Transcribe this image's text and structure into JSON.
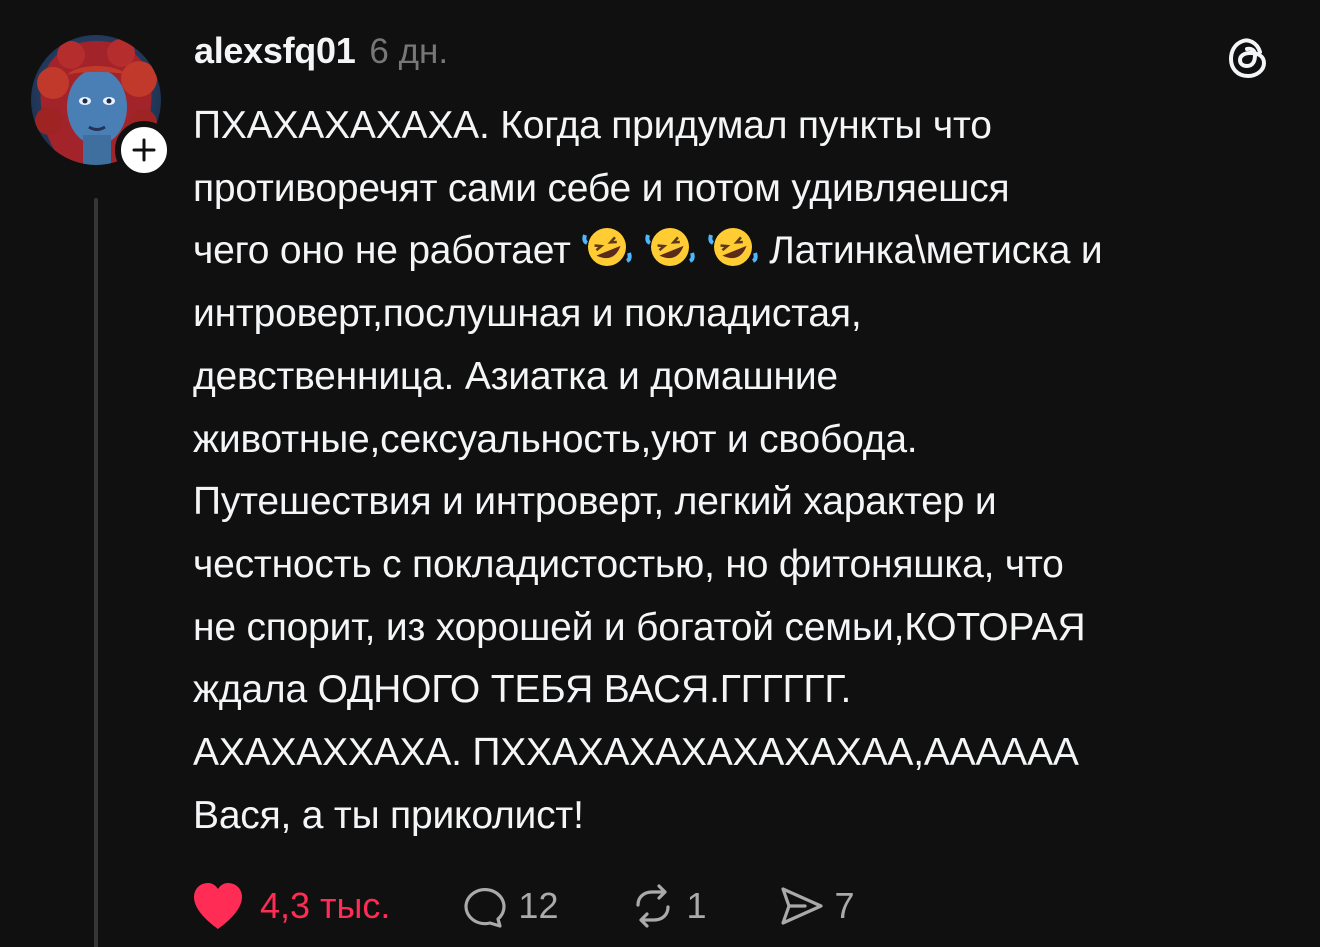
{
  "post": {
    "username": "alexsfq01",
    "time": "6 дн.",
    "lines": [
      {
        "text": "ПХАХАХАХАХА. Когда придумал пункты что"
      },
      {
        "text": "противоречят сами себе и потом удивляешся"
      },
      {
        "text_before": "чего оно не работает ",
        "emoji": [
          "rolling-on-floor-laughing",
          "rolling-on-floor-laughing",
          "rolling-on-floor-laughing"
        ],
        "text_after": " Латинка\\метиска и"
      },
      {
        "text": "интроверт,послушная и покладистая,"
      },
      {
        "text": "девственница. Азиатка и домашние"
      },
      {
        "text": "животные,сексуальность,уют и свобода."
      },
      {
        "text": "Путешествия и интроверт, легкий характер и"
      },
      {
        "text": "честность с покладистостью, но фитоняшка, что"
      },
      {
        "text": "не спорит, из хорошей и богатой семьи,КОТОРАЯ"
      },
      {
        "text": "ждала ОДНОГО ТЕБЯ ВАСЯ.ГГГГГГ."
      },
      {
        "text": "АХАХАХХАХА. ПХХАХАХАХАХАХАХАА,АААААА"
      },
      {
        "text": "Вася, а ты приколист!"
      }
    ]
  },
  "actions": {
    "likes": "4,3 тыс.",
    "replies": "12",
    "reposts": "1",
    "shares": "7"
  },
  "icons": {
    "follow": "plus-icon",
    "app": "threads-logo-icon",
    "like": "heart-icon",
    "reply": "comment-icon",
    "repost": "repost-icon",
    "share": "send-icon"
  },
  "colors": {
    "background": "#101010",
    "text": "#f3f5f7",
    "muted": "#777777",
    "like": "#ff2d55"
  }
}
